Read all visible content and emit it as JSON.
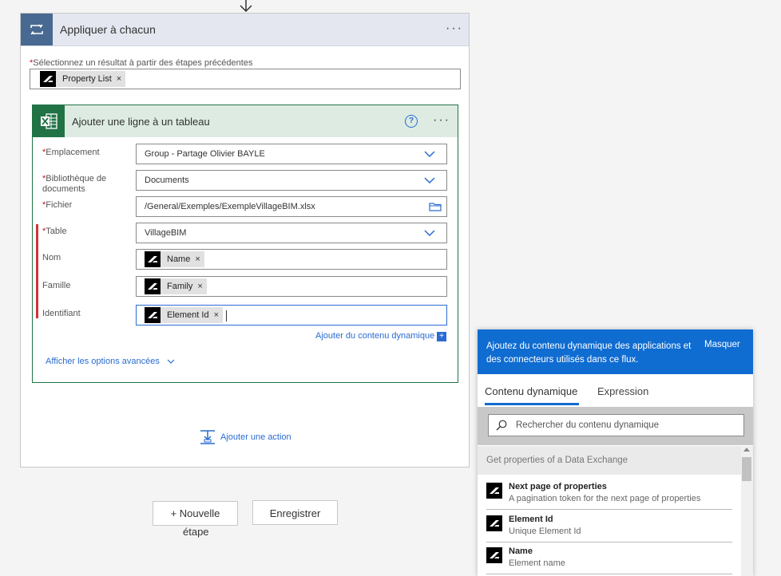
{
  "loop": {
    "title": "Appliquer à chacun",
    "select_label": "Sélectionnez un résultat à partir des étapes précédentes",
    "select_token": "Property List",
    "more": "···"
  },
  "action": {
    "title": "Ajouter une ligne à un tableau",
    "help": "?",
    "more": "···",
    "fields": {
      "location_label": "Emplacement",
      "location_value": "Group - Partage Olivier BAYLE",
      "library_label_1": "Bibliothèque de",
      "library_label_2": "documents",
      "library_value": "Documents",
      "file_label": "Fichier",
      "file_value": "/General/Exemples/ExempleVillageBIM.xlsx",
      "table_label": "Table",
      "table_value": "VillageBIM",
      "name_label": "Nom",
      "name_token": "Name",
      "family_label": "Famille",
      "family_token": "Family",
      "id_label": "Identifiant",
      "id_token": "Element Id"
    },
    "add_dynamic": "Ajouter du contenu dynamique",
    "add_dynamic_plus": "+",
    "advanced": "Afficher les options avancées"
  },
  "add_action": "Ajouter une action",
  "buttons": {
    "new_step_1": "+ Nouvelle",
    "new_step_2": "étape",
    "save": "Enregistrer"
  },
  "panel": {
    "description": "Ajoutez du contenu dynamique des applications et des connecteurs utilisés dans ce flux.",
    "hide": "Masquer",
    "tabs": [
      "Contenu dynamique",
      "Expression"
    ],
    "search_placeholder": "Rechercher du contenu dynamique",
    "group": "Get properties of a Data Exchange",
    "items": [
      {
        "title": "Next page of properties",
        "subtitle": "A pagination token for the next page of properties"
      },
      {
        "title": "Element Id",
        "subtitle": "Unique Element Id"
      },
      {
        "title": "Name",
        "subtitle": "Element name"
      }
    ]
  },
  "colors": {
    "loop_header": "#486991",
    "excel": "#217346",
    "accent": "#0f6cd1",
    "required": "#c50f1f"
  }
}
